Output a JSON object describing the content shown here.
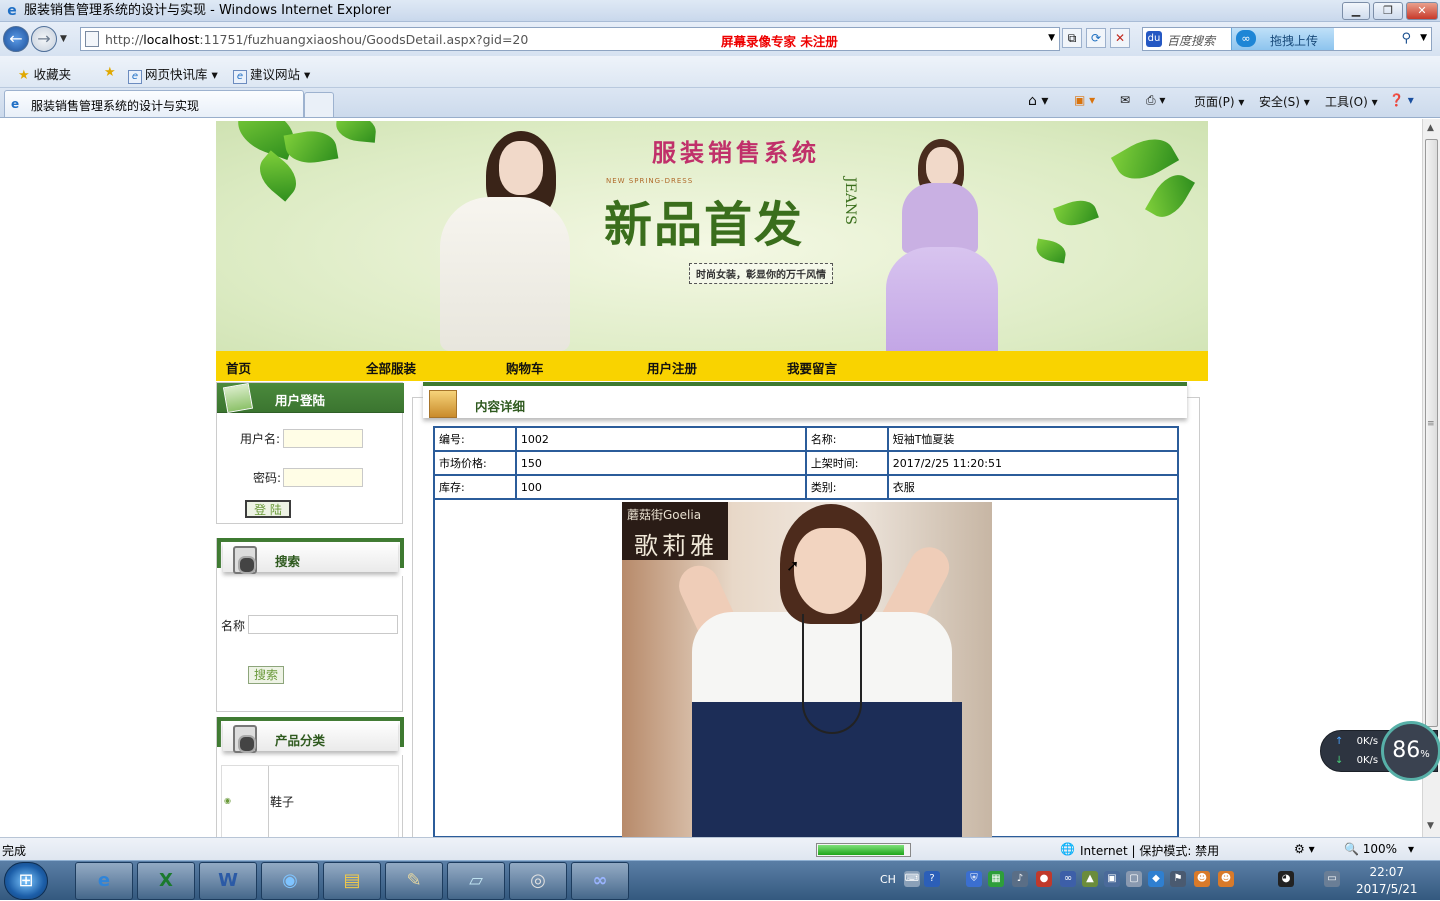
{
  "window": {
    "title": "服装销售管理系统的设计与实现 - Windows Internet Explorer"
  },
  "addressbar": {
    "url_prefix": "http://",
    "url_host": "localhost",
    "url_path": ":11751/fuzhuangxiaoshou/GoodsDetail.aspx?gid=20",
    "overlay_text": "屏幕录像专家  未注册",
    "search_placeholder": "百度搜索",
    "upload_label": "拖拽上传"
  },
  "favorites": {
    "favorites_label": "收藏夹",
    "items": [
      "网页快讯库",
      "建议网站"
    ]
  },
  "tabs": {
    "active_label": "服装销售管理系统的设计与实现"
  },
  "commandbar": {
    "page_label": "页面(P)",
    "safety_label": "安全(S)",
    "tools_label": "工具(O)"
  },
  "banner": {
    "site_title": "服装销售系统",
    "spring_text": "NEW SPRING-DRESS",
    "new_text": "新品首发",
    "jeans_text": "JEANS",
    "tagline": "时尚女装，彰显你的万千风情"
  },
  "menu": {
    "items": [
      "首页",
      "全部服装",
      "购物车",
      "用户注册",
      "我要留言"
    ]
  },
  "login": {
    "header": "用户登陆",
    "username_label": "用户名:",
    "password_label": "密码:",
    "submit_label": "登 陆"
  },
  "search": {
    "header": "搜索",
    "name_label": "名称",
    "submit_label": "搜索"
  },
  "categories": {
    "header": "产品分类",
    "items": [
      "鞋子"
    ]
  },
  "detail": {
    "header": "内容详细",
    "rows": [
      {
        "label1": "编号:",
        "value1": "1002",
        "label2": "名称:",
        "value2": "短袖T恤夏装"
      },
      {
        "label1": "市场价格:",
        "value1": "150",
        "label2": "上架时间:",
        "value2": "2017/2/25 11:20:51"
      },
      {
        "label1": "库存:",
        "value1": "100",
        "label2": "类别:",
        "value2": "衣服"
      }
    ],
    "photo_logo_line1": "蘑菇街Goelia",
    "photo_logo_line2": "歌莉雅"
  },
  "statusbar": {
    "status_text": "完成",
    "zone_text": "Internet | 保护模式: 禁用",
    "zoom_text": "100%",
    "progress_fraction": 0.95
  },
  "network_widget": {
    "upload_rate": "0K/s",
    "download_rate": "0K/s",
    "percent": "86",
    "percent_unit": "%"
  },
  "taskbar": {
    "ime_label": "CH",
    "time": "22:07",
    "date": "2017/5/21"
  }
}
